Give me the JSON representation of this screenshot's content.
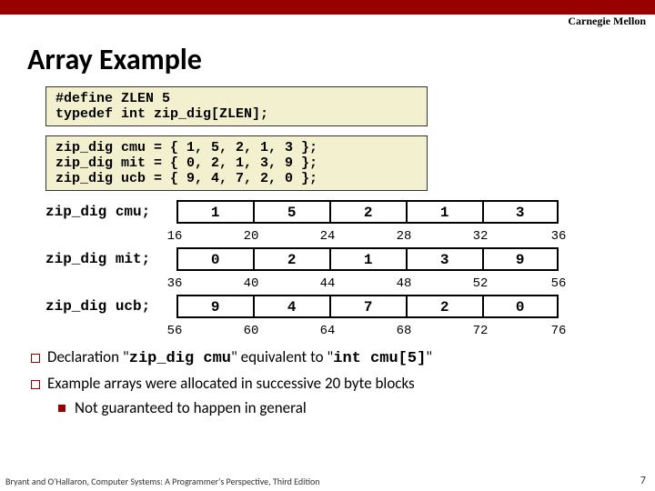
{
  "brand": "Carnegie Mellon",
  "title": "Array Example",
  "codebox1": "#define ZLEN 5\ntypedef int zip_dig[ZLEN];",
  "codebox2": "zip_dig cmu = { 1, 5, 2, 1, 3 };\nzip_dig mit = { 0, 2, 1, 3, 9 };\nzip_dig ucb = { 9, 4, 7, 2, 0 };",
  "arrays": [
    {
      "label": "zip_dig cmu;",
      "values": [
        "1",
        "5",
        "2",
        "1",
        "3"
      ],
      "addrs": [
        "16",
        "20",
        "24",
        "28",
        "32",
        "36"
      ]
    },
    {
      "label": "zip_dig mit;",
      "values": [
        "0",
        "2",
        "1",
        "3",
        "9"
      ],
      "addrs": [
        "36",
        "40",
        "44",
        "48",
        "52",
        "56"
      ]
    },
    {
      "label": "zip_dig ucb;",
      "values": [
        "9",
        "4",
        "7",
        "2",
        "0"
      ],
      "addrs": [
        "56",
        "60",
        "64",
        "68",
        "72",
        "76"
      ]
    }
  ],
  "bullet1_a": "Declaration \"",
  "bullet1_b": "zip_dig cmu",
  "bullet1_c": "\" equivalent to \"",
  "bullet1_d": "int cmu[5]",
  "bullet1_e": "\"",
  "bullet2": "Example arrays were allocated in successive 20 byte blocks",
  "bullet3": "Not guaranteed to happen in general",
  "footer": "Bryant and O'Hallaron, Computer Systems: A Programmer's Perspective, Third Edition",
  "pagenum": "7"
}
